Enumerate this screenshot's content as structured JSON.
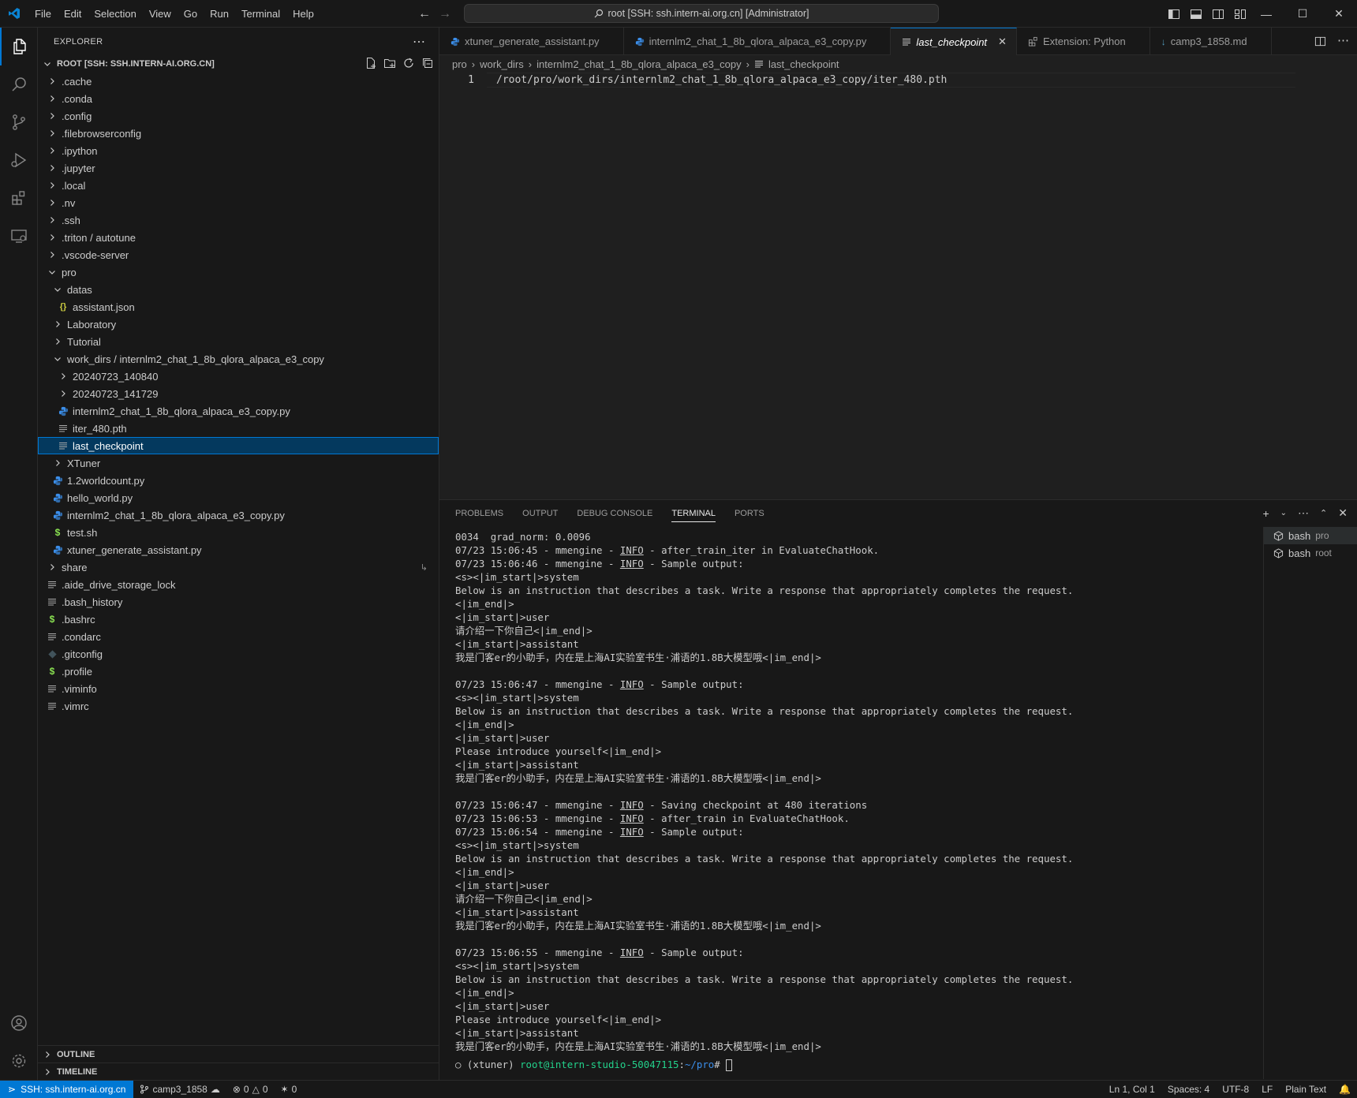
{
  "menu": [
    "File",
    "Edit",
    "Selection",
    "View",
    "Go",
    "Run",
    "Terminal",
    "Help"
  ],
  "command_center": "root [SSH: ssh.intern-ai.org.cn] [Administrator]",
  "explorer": {
    "title": "EXPLORER",
    "root_label": "ROOT [SSH: SSH.INTERN-AI.ORG.CN]",
    "items": [
      {
        "label": ".cache",
        "type": "folder",
        "depth": 0,
        "open": false
      },
      {
        "label": ".conda",
        "type": "folder",
        "depth": 0,
        "open": false
      },
      {
        "label": ".config",
        "type": "folder",
        "depth": 0,
        "open": false
      },
      {
        "label": ".filebrowserconfig",
        "type": "folder",
        "depth": 0,
        "open": false
      },
      {
        "label": ".ipython",
        "type": "folder",
        "depth": 0,
        "open": false
      },
      {
        "label": ".jupyter",
        "type": "folder",
        "depth": 0,
        "open": false
      },
      {
        "label": ".local",
        "type": "folder",
        "depth": 0,
        "open": false
      },
      {
        "label": ".nv",
        "type": "folder",
        "depth": 0,
        "open": false
      },
      {
        "label": ".ssh",
        "type": "folder",
        "depth": 0,
        "open": false
      },
      {
        "label": ".triton / autotune",
        "type": "folder",
        "depth": 0,
        "open": false
      },
      {
        "label": ".vscode-server",
        "type": "folder",
        "depth": 0,
        "open": false
      },
      {
        "label": "pro",
        "type": "folder",
        "depth": 0,
        "open": true
      },
      {
        "label": "datas",
        "type": "folder",
        "depth": 1,
        "open": true
      },
      {
        "label": "assistant.json",
        "type": "json",
        "depth": 2
      },
      {
        "label": "Laboratory",
        "type": "folder",
        "depth": 1,
        "open": false
      },
      {
        "label": "Tutorial",
        "type": "folder",
        "depth": 1,
        "open": false
      },
      {
        "label": "work_dirs / internlm2_chat_1_8b_qlora_alpaca_e3_copy",
        "type": "folder",
        "depth": 1,
        "open": true
      },
      {
        "label": "20240723_140840",
        "type": "folder",
        "depth": 2,
        "open": false
      },
      {
        "label": "20240723_141729",
        "type": "folder",
        "depth": 2,
        "open": false
      },
      {
        "label": "internlm2_chat_1_8b_qlora_alpaca_e3_copy.py",
        "type": "py",
        "depth": 2
      },
      {
        "label": "iter_480.pth",
        "type": "text",
        "depth": 2
      },
      {
        "label": "last_checkpoint",
        "type": "text",
        "depth": 2,
        "selected": true
      },
      {
        "label": "XTuner",
        "type": "folder",
        "depth": 1,
        "open": false
      },
      {
        "label": "1.2worldcount.py",
        "type": "py",
        "depth": 1
      },
      {
        "label": "hello_world.py",
        "type": "py",
        "depth": 1
      },
      {
        "label": "internlm2_chat_1_8b_qlora_alpaca_e3_copy.py",
        "type": "py",
        "depth": 1
      },
      {
        "label": "test.sh",
        "type": "sh",
        "depth": 1
      },
      {
        "label": "xtuner_generate_assistant.py",
        "type": "py",
        "depth": 1
      },
      {
        "label": "share",
        "type": "folder",
        "depth": 0,
        "open": false
      },
      {
        "label": ".aide_drive_storage_lock",
        "type": "text",
        "depth": 0
      },
      {
        "label": ".bash_history",
        "type": "text",
        "depth": 0
      },
      {
        "label": ".bashrc",
        "type": "sh",
        "depth": 0
      },
      {
        "label": ".condarc",
        "type": "text",
        "depth": 0
      },
      {
        "label": ".gitconfig",
        "type": "git",
        "depth": 0
      },
      {
        "label": ".profile",
        "type": "sh",
        "depth": 0
      },
      {
        "label": ".viminfo",
        "type": "text",
        "depth": 0
      },
      {
        "label": ".vimrc",
        "type": "text",
        "depth": 0
      }
    ],
    "outline": "OUTLINE",
    "timeline": "TIMELINE"
  },
  "tabs": [
    {
      "label": "xtuner_generate_assistant.py",
      "icon": "python-icon"
    },
    {
      "label": "internlm2_chat_1_8b_qlora_alpaca_e3_copy.py",
      "icon": "python-icon"
    },
    {
      "label": "last_checkpoint",
      "icon": "text-icon",
      "active": true
    },
    {
      "label": "Extension: Python",
      "icon": "extension-icon"
    },
    {
      "label": "camp3_1858.md",
      "icon": "markdown-icon"
    }
  ],
  "breadcrumb": [
    "pro",
    "work_dirs",
    "internlm2_chat_1_8b_qlora_alpaca_e3_copy",
    "last_checkpoint"
  ],
  "editor": {
    "line_number": "1",
    "line_text": "/root/pro/work_dirs/internlm2_chat_1_8b_qlora_alpaca_e3_copy/iter_480.pth"
  },
  "panel": {
    "tabs": [
      "PROBLEMS",
      "OUTPUT",
      "DEBUG CONSOLE",
      "TERMINAL",
      "PORTS"
    ],
    "active_tab": "TERMINAL",
    "terminals": [
      {
        "name": "bash",
        "cwd": "pro"
      },
      {
        "name": "bash",
        "cwd": "root"
      }
    ],
    "terminal_lines": [
      "0034  grad_norm: 0.0096",
      "07/23 15:06:45 - mmengine - |INFO| - after_train_iter in EvaluateChatHook.",
      "07/23 15:06:46 - mmengine - |INFO| - Sample output:",
      "<s><|im_start|>system",
      "Below is an instruction that describes a task. Write a response that appropriately completes the request.",
      "<|im_end|>",
      "<|im_start|>user",
      "请介绍一下你自己<|im_end|>",
      "<|im_start|>assistant",
      "我是门客er的小助手，内在是上海AI实验室书生·浦语的1.8B大模型哦<|im_end|>",
      "",
      "07/23 15:06:47 - mmengine - |INFO| - Sample output:",
      "<s><|im_start|>system",
      "Below is an instruction that describes a task. Write a response that appropriately completes the request.",
      "<|im_end|>",
      "<|im_start|>user",
      "Please introduce yourself<|im_end|>",
      "<|im_start|>assistant",
      "我是门客er的小助手，内在是上海AI实验室书生·浦语的1.8B大模型哦<|im_end|>",
      "",
      "07/23 15:06:47 - mmengine - |INFO| - Saving checkpoint at 480 iterations",
      "07/23 15:06:53 - mmengine - |INFO| - after_train in EvaluateChatHook.",
      "07/23 15:06:54 - mmengine - |INFO| - Sample output:",
      "<s><|im_start|>system",
      "Below is an instruction that describes a task. Write a response that appropriately completes the request.",
      "<|im_end|>",
      "<|im_start|>user",
      "请介绍一下你自己<|im_end|>",
      "<|im_start|>assistant",
      "我是门客er的小助手，内在是上海AI实验室书生·浦语的1.8B大模型哦<|im_end|>",
      "",
      "07/23 15:06:55 - mmengine - |INFO| - Sample output:",
      "<s><|im_start|>system",
      "Below is an instruction that describes a task. Write a response that appropriately completes the request.",
      "<|im_end|>",
      "<|im_start|>user",
      "Please introduce yourself<|im_end|>",
      "<|im_start|>assistant",
      "我是门客er的小助手，内在是上海AI实验室书生·浦语的1.8B大模型哦<|im_end|>"
    ],
    "prompt_env": "(xtuner)",
    "prompt_user": "root@intern-studio-50047115",
    "prompt_path": "~/pro",
    "prompt_suffix": "#"
  },
  "status": {
    "remote": "SSH: ssh.intern-ai.org.cn",
    "branch": "camp3_1858",
    "errors": "0",
    "warnings": "0",
    "ports": "0",
    "position": "Ln 1, Col 1",
    "spaces": "Spaces: 4",
    "encoding": "UTF-8",
    "eol": "LF",
    "language": "Plain Text"
  },
  "colors": {
    "accent": "#0078d4",
    "selection": "#04395e",
    "python": "#3b8eea",
    "json": "#cbcb41",
    "shell": "#89e051"
  }
}
